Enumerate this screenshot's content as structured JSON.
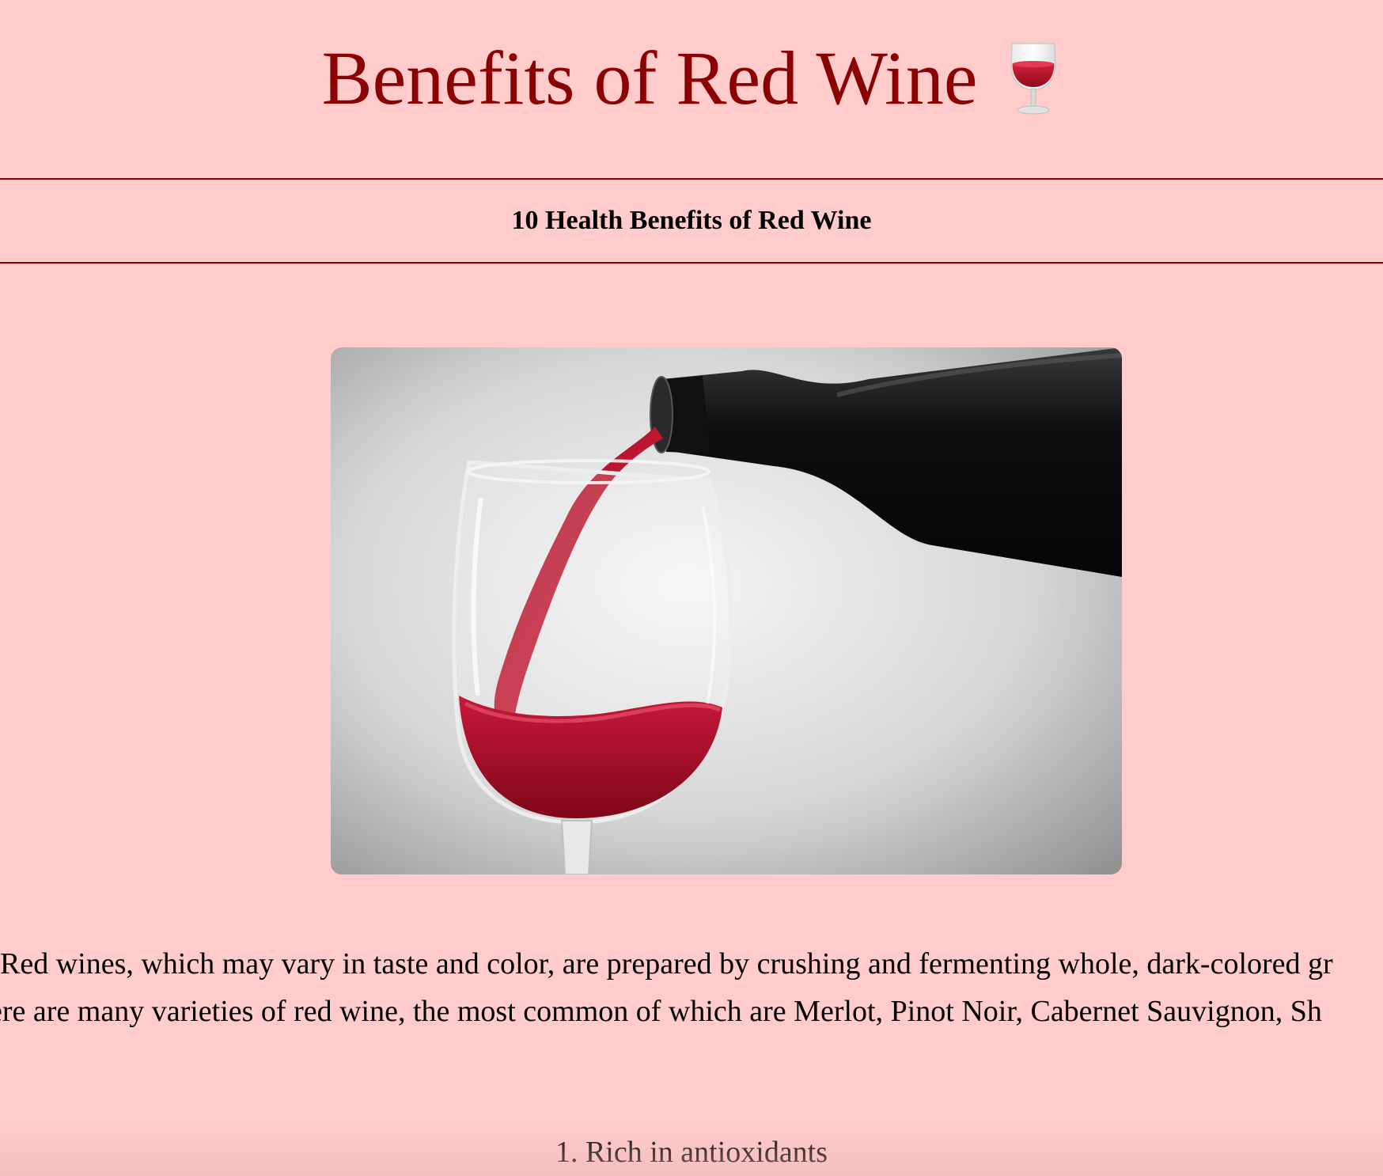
{
  "header": {
    "title": "Benefits of Red Wine",
    "title_icon": "wine-glass-icon",
    "subtitle": "10 Health Benefits of Red Wine"
  },
  "hero_image": {
    "subject": "wine-pouring-photo"
  },
  "intro": {
    "line1": "Red wines, which may vary in taste and color, are prepared by crushing and fermenting whole, dark-colored gr",
    "line2": "ere are many varieties of red wine, the most common of which are Merlot, Pinot Noir, Cabernet Sauvignon, Sh"
  },
  "list": {
    "first_item": "1. Rich in antioxidants"
  },
  "colors": {
    "background": "#ffcccb",
    "accent": "#8b0000",
    "wine": "#b5122a"
  }
}
